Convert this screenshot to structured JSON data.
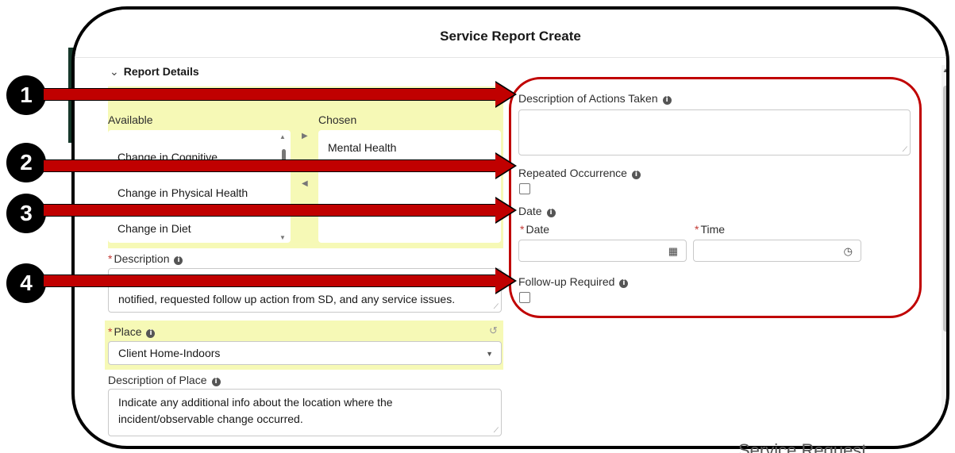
{
  "modal": {
    "title": "Service Report Create"
  },
  "section": {
    "label": "Report Details"
  },
  "dual_list": {
    "available_label": "Available",
    "chosen_label": "Chosen",
    "available_items": [
      "Change in Cognitive",
      "Change in Physical Health",
      "Change in Diet"
    ],
    "chosen_items": [
      "Mental Health"
    ]
  },
  "description": {
    "label": "Description",
    "value": "notified, requested follow up action from SD, and any service issues."
  },
  "place": {
    "label": "Place",
    "value": "Client Home-Indoors"
  },
  "description_of_place": {
    "label": "Description of Place",
    "placeholder_line1": "Indicate any additional info about the location where the",
    "placeholder_line2": "incident/observable change occurred."
  },
  "actions_taken": {
    "label": "Description of Actions Taken",
    "value": ""
  },
  "repeated": {
    "label": "Repeated Occurrence",
    "checked": false
  },
  "date_group": {
    "label": "Date",
    "date_label": "Date",
    "time_label": "Time",
    "date_value": "",
    "time_value": ""
  },
  "follow_up": {
    "label": "Follow-up Required",
    "checked": false
  },
  "bottom_partial": {
    "right_text": "Service Request"
  },
  "callouts": [
    "1",
    "2",
    "3",
    "4"
  ],
  "colors": {
    "highlight": "#f6f9b6",
    "callout_red": "#c00000",
    "required": "#c23934"
  },
  "icons": {
    "info": "info-icon",
    "calendar": "calendar-icon",
    "clock": "clock-icon",
    "undo": "undo-icon"
  }
}
